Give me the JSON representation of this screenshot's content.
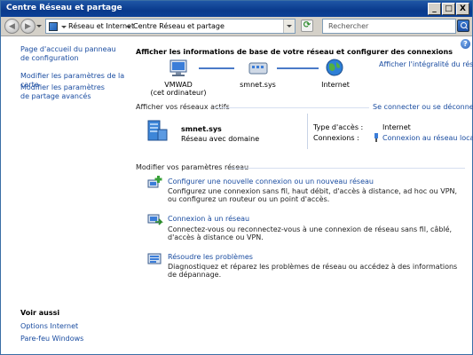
{
  "window": {
    "title": "Centre Réseau et partage",
    "controls": [
      "_",
      "□",
      "X"
    ]
  },
  "address_bar": {
    "segments": [
      "Réseau et Internet",
      "Centre Réseau et partage"
    ],
    "search_placeholder": "Rechercher"
  },
  "left_pane": {
    "links": [
      "Page d'accueil du panneau de configuration",
      "Modifier les paramètres de la carte",
      "Modifier les paramètres de partage avancés"
    ],
    "see_also_heading": "Voir aussi",
    "see_also_links": [
      "Options Internet",
      "Pare-feu Windows"
    ]
  },
  "main": {
    "heading": "Afficher les informations de base de votre réseau et configurer des connexions",
    "full_map_link": "Afficher l'intégralité du réseau",
    "map_nodes": [
      {
        "label_line1": "VMWAD",
        "label_line2": "(cet ordinateur)"
      },
      {
        "label_line1": "smnet.sys",
        "label_line2": ""
      },
      {
        "label_line1": "Internet",
        "label_line2": ""
      }
    ],
    "active_networks_heading": "Afficher vos réseaux actifs",
    "connect_link": "Se connecter ou se déconnecter",
    "network": {
      "name": "smnet.sys",
      "type": "Réseau avec domaine",
      "access_type_label": "Type d'accès :",
      "access_type_value": "Internet",
      "connections_label": "Connexions :",
      "connections_value": "Connexion au réseau local"
    },
    "modify_heading": "Modifier vos paramètres réseau",
    "tasks": [
      {
        "icon": "new-connection-icon",
        "title": "Configurer une nouvelle connexion ou un nouveau réseau",
        "desc": "Configurez une connexion sans fil, haut débit, d'accès à distance, ad hoc ou VPN, ou configurez un routeur ou un point d'accès."
      },
      {
        "icon": "connect-network-icon",
        "title": "Connexion à un réseau",
        "desc": "Connectez-vous ou reconnectez-vous à une connexion de réseau sans fil, câblé, d'accès à distance ou VPN."
      },
      {
        "icon": "troubleshoot-icon",
        "title": "Résoudre les problèmes",
        "desc": "Diagnostiquez et réparez les problèmes de réseau ou accédez à des informations de dépannage."
      }
    ]
  },
  "colors": {
    "titlebar": "#0a3a8c",
    "link": "#1a4ca0",
    "chrome": "#d4d0c8",
    "map_line": "#4a7ac8"
  }
}
